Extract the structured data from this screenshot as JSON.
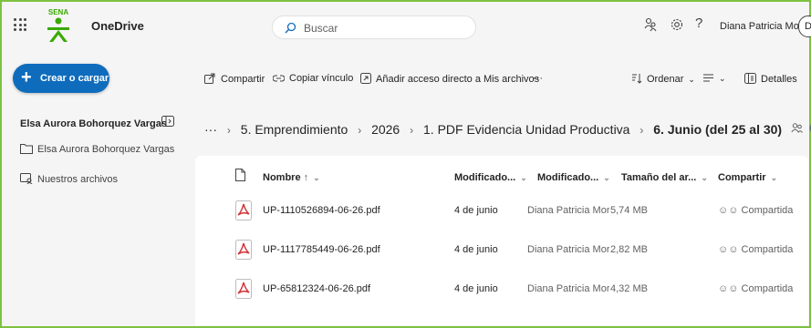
{
  "header": {
    "app_name": "OneDrive",
    "logo_text": "SENA",
    "search_placeholder": "Buscar",
    "user_name": "Diana Patricia Mor...",
    "avatar_initial": "D"
  },
  "sidebar": {
    "create_label": "Crear o cargar",
    "title": "Elsa Aurora Bohorquez Vargas",
    "items": [
      {
        "label": "Elsa Aurora Bohorquez Vargas",
        "icon": "folder-icon"
      },
      {
        "label": "Nuestros archivos",
        "icon": "shared-files-icon"
      }
    ]
  },
  "toolbar": {
    "share": "Compartir",
    "copy_link": "Copiar vínculo",
    "add_shortcut": "Añadir acceso directo a Mis archivos",
    "more": "···",
    "sort": "Ordenar",
    "details": "Detalles"
  },
  "breadcrumb": {
    "overflow": "···",
    "items": [
      "5. Emprendimiento",
      "2026",
      "1. PDF Evidencia Unidad Productiva"
    ],
    "current": "6. Junio (del 25 al 30)"
  },
  "table": {
    "columns": {
      "name": "Nombre",
      "name_sort": "↑",
      "modified": "Modificado...",
      "modified_by": "Modificado...",
      "size": "Tamaño del ar...",
      "sharing": "Compartir"
    },
    "rows": [
      {
        "name": "UP-1110526894-06-26.pdf",
        "modified": "4 de junio",
        "modified_by": "Diana Patricia Mora",
        "size": "5,74 MB",
        "sharing": "Compartida"
      },
      {
        "name": "UP-1117785449-06-26.pdf",
        "modified": "4 de junio",
        "modified_by": "Diana Patricia Mora",
        "size": "2,82 MB",
        "sharing": "Compartida"
      },
      {
        "name": "UP-65812324-06-26.pdf",
        "modified": "4 de junio",
        "modified_by": "Diana Patricia Mora",
        "size": "4,32 MB",
        "sharing": "Compartida"
      }
    ]
  },
  "colors": {
    "accent": "#0f6cbd",
    "frame": "#7cc242",
    "sena_green": "#39a900",
    "pdf_red": "#d13438"
  }
}
